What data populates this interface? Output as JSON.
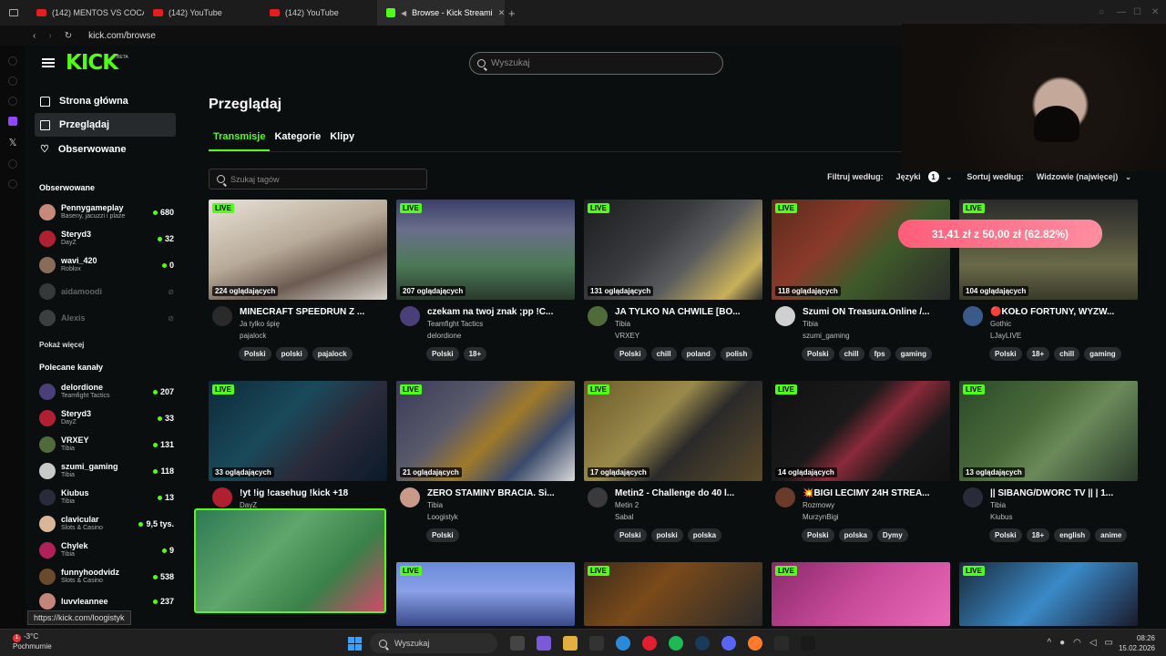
{
  "browser": {
    "tabs": [
      {
        "label": "(142) MENTOS VS COCA C",
        "icon": "youtube-icon"
      },
      {
        "label": "(142) YouTube",
        "icon": "youtube-icon"
      },
      {
        "label": "(142) YouTube",
        "icon": "youtube-icon"
      },
      {
        "label": "Browse - Kick Streami",
        "icon": "kick-icon",
        "active": true
      }
    ],
    "url": "kick.com/browse",
    "status_url": "https://kick.com/loogistyk"
  },
  "header": {
    "logo": "KICK",
    "logo_badge": "BETA",
    "search_placeholder": "Wyszukaj"
  },
  "sidebar": {
    "nav": [
      {
        "label": "Strona główna",
        "icon": "home-icon"
      },
      {
        "label": "Przeglądaj",
        "icon": "browse-icon",
        "active": true
      },
      {
        "label": "Obserwowane",
        "icon": "heart-icon"
      }
    ],
    "followed_title": "Obserwowane",
    "followed": [
      {
        "name": "Pennygameplay",
        "category": "Baseny, jacuzzi i plaże",
        "viewers": "680"
      },
      {
        "name": "Steryd3",
        "category": "DayZ",
        "viewers": "32"
      },
      {
        "name": "wavi_420",
        "category": "Roblox",
        "viewers": "0"
      },
      {
        "name": "aidamoodi",
        "category": "",
        "viewers": "",
        "offline": true
      },
      {
        "name": "Alexis",
        "category": "",
        "viewers": "",
        "offline": true
      }
    ],
    "show_more": "Pokaż więcej",
    "recommended_title": "Polecane kanały",
    "recommended": [
      {
        "name": "delordione",
        "category": "Teamfight Tactics",
        "viewers": "207"
      },
      {
        "name": "Steryd3",
        "category": "DayZ",
        "viewers": "33"
      },
      {
        "name": "VRXEY",
        "category": "Tibia",
        "viewers": "131"
      },
      {
        "name": "szumi_gaming",
        "category": "Tibia",
        "viewers": "118"
      },
      {
        "name": "Kiubus",
        "category": "Tibia",
        "viewers": "13"
      },
      {
        "name": "clavicular",
        "category": "Slots & Casino",
        "viewers": "9,5 tys."
      },
      {
        "name": "Chylek",
        "category": "Tibia",
        "viewers": "9"
      },
      {
        "name": "funnyhoodvidz",
        "category": "Slots & Casino",
        "viewers": "538"
      },
      {
        "name": "luvvleannee",
        "category": "",
        "viewers": "237"
      }
    ]
  },
  "main": {
    "title": "Przeglądaj",
    "tabs": [
      "Transmisje",
      "Kategorie",
      "Klipy"
    ],
    "tag_search_placeholder": "Szukaj tagów",
    "filter_label": "Filtruj według:",
    "filter_value": "Języki",
    "filter_count": "1",
    "sort_label": "Sortuj według:",
    "sort_value": "Widzowie (najwięcej)",
    "live_label": "LIVE",
    "donation_overlay": "31,41 zł z 50,00 zł (62.82%)"
  },
  "streams": [
    {
      "title": "MINECRAFT SPEEDRUN Z ...",
      "category": "Ja tylko śpię",
      "user": "pajalock",
      "viewers": "224 oglądających",
      "tags": [
        "Polski",
        "polski",
        "pajalock"
      ]
    },
    {
      "title": "czekam na twoj znak ;pp !C...",
      "category": "Teamfight Tactics",
      "user": "delordione",
      "viewers": "207 oglądających",
      "tags": [
        "Polski",
        "18+"
      ]
    },
    {
      "title": "JA TYLKO NA CHWILE [BO...",
      "category": "Tibia",
      "user": "VRXEY",
      "viewers": "131 oglądających",
      "tags": [
        "Polski",
        "chill",
        "poland",
        "polish"
      ]
    },
    {
      "title": "Szumi ON Treasura.Online /...",
      "category": "Tibia",
      "user": "szumi_gaming",
      "viewers": "118 oglądających",
      "tags": [
        "Polski",
        "chill",
        "fps",
        "gaming"
      ]
    },
    {
      "title": "🔴KOŁO FORTUNY, WYZW...",
      "category": "Gothic",
      "user": "LJayLIVE",
      "viewers": "104 oglądających",
      "tags": [
        "Polski",
        "18+",
        "chill",
        "gaming"
      ]
    },
    {
      "title": "!yt !ig !casehug !kick +18",
      "category": "DayZ",
      "user": "",
      "viewers": "33 oglądających",
      "tags": []
    },
    {
      "title": "ZERO STAMINY BRACIA. Si...",
      "category": "Tibia",
      "user": "Loogistyk",
      "viewers": "21 oglądających",
      "tags": [
        "Polski"
      ]
    },
    {
      "title": "Metin2 - Challenge do 40 l...",
      "category": "Metin 2",
      "user": "Sabal",
      "viewers": "17 oglądających",
      "tags": [
        "Polski",
        "polski",
        "polska"
      ]
    },
    {
      "title": "💥BIGI LECIMY 24H STREA...",
      "category": "Rozmowy",
      "user": "MurzynBigi",
      "viewers": "14 oglądających",
      "tags": [
        "Polski",
        "polska",
        "Dymy"
      ]
    },
    {
      "title": "|| SIBANG/DWORC TV || | 1...",
      "category": "Tibia",
      "user": "Kiubus",
      "viewers": "13 oglądających",
      "tags": [
        "Polski",
        "18+",
        "english",
        "anime"
      ]
    }
  ],
  "taskbar": {
    "weather_temp": "-3°C",
    "weather_desc": "Pochmurnie",
    "notification_count": "1",
    "search_placeholder": "Wyszukaj",
    "time": "08:26",
    "date": "15.02.2026"
  },
  "colors": {
    "accent": "#53fc18",
    "background": "#0b0e0f",
    "overlay": "#ff6f88"
  }
}
